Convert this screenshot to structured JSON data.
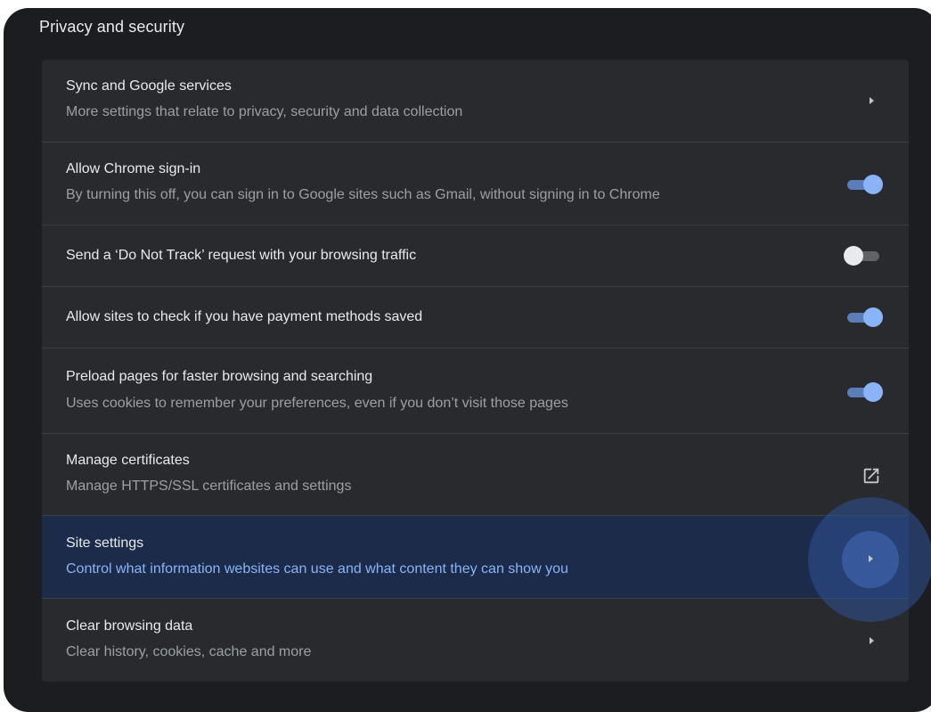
{
  "section": {
    "title": "Privacy and security"
  },
  "rows": [
    {
      "title": "Sync and Google services",
      "subtitle": "More settings that relate to privacy, security and data collection",
      "control": "chevron-right-icon"
    },
    {
      "title": "Allow Chrome sign-in",
      "subtitle": "By turning this off, you can sign in to Google sites such as Gmail, without signing in to Chrome",
      "control": "toggle",
      "toggle_on": true
    },
    {
      "title": "Send a ‘Do Not Track’ request with your browsing traffic",
      "control": "toggle",
      "toggle_on": false
    },
    {
      "title": "Allow sites to check if you have payment methods saved",
      "control": "toggle",
      "toggle_on": true
    },
    {
      "title": "Preload pages for faster browsing and searching",
      "subtitle": "Uses cookies to remember your preferences, even if you don’t visit those pages",
      "control": "toggle",
      "toggle_on": true
    },
    {
      "title": "Manage certificates",
      "subtitle": "Manage HTTPS/SSL certificates and settings",
      "control": "open-in-new-icon"
    },
    {
      "title": "Site settings",
      "subtitle": "Control what information websites can use and what content they can show you",
      "control": "chevron-right-icon",
      "highlighted": true
    },
    {
      "title": "Clear browsing data",
      "subtitle": "Clear history, cookies, cache and more",
      "control": "chevron-right-icon"
    }
  ],
  "colors": {
    "background": "#1c1d20",
    "card": "#292a2d",
    "accent": "#8ab4f8",
    "highlight_row": "#1b2b49"
  }
}
